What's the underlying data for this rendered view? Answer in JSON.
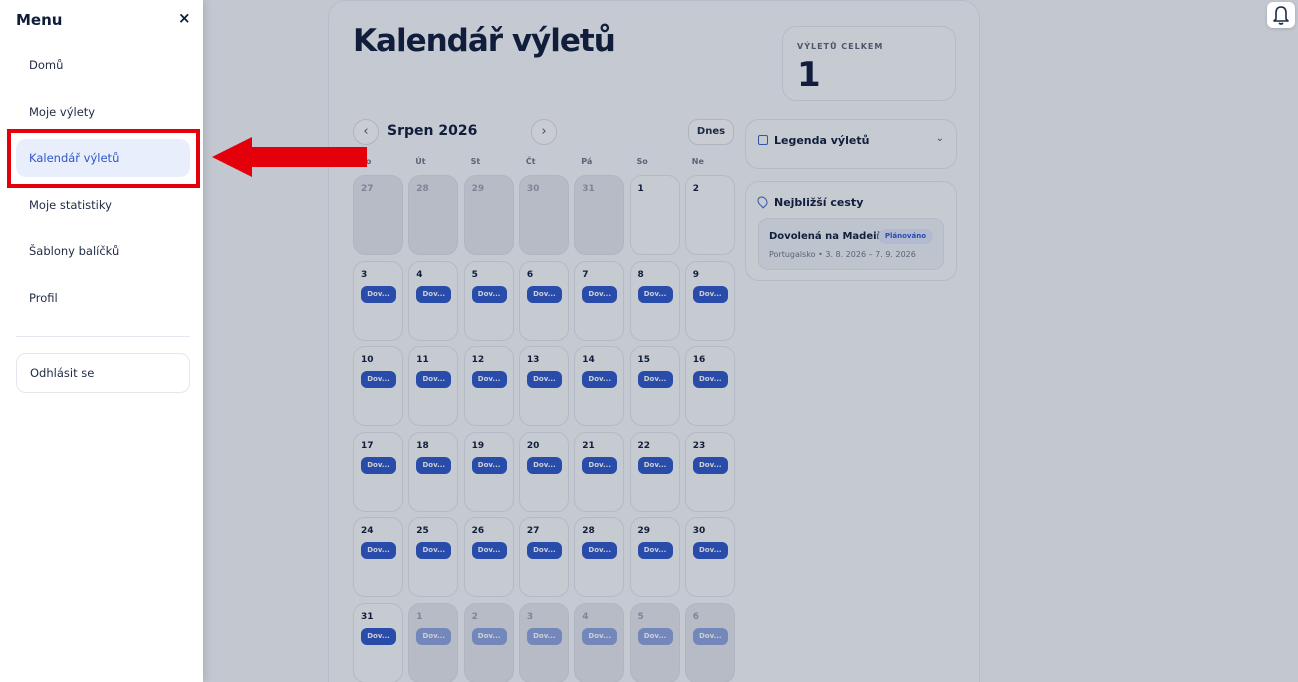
{
  "page": {
    "title": "Kalendář výletů",
    "stat_label": "VÝLETŮ CELKEM",
    "stat_value": "1"
  },
  "calendar": {
    "month": "Srpen 2026",
    "today_label": "Dnes",
    "prev_icon": "chevron-left-icon",
    "next_icon": "chevron-right-icon",
    "weekdays": [
      "Po",
      "Út",
      "St",
      "Čt",
      "Pá",
      "So",
      "Ne"
    ],
    "event_label": "Dov...",
    "weeks": [
      [
        {
          "d": "27",
          "out": true,
          "ev": false
        },
        {
          "d": "28",
          "out": true,
          "ev": false
        },
        {
          "d": "29",
          "out": true,
          "ev": false
        },
        {
          "d": "30",
          "out": true,
          "ev": false
        },
        {
          "d": "31",
          "out": true,
          "ev": false
        },
        {
          "d": "1",
          "out": false,
          "ev": false
        },
        {
          "d": "2",
          "out": false,
          "ev": false
        }
      ],
      [
        {
          "d": "3",
          "out": false,
          "ev": true
        },
        {
          "d": "4",
          "out": false,
          "ev": true
        },
        {
          "d": "5",
          "out": false,
          "ev": true
        },
        {
          "d": "6",
          "out": false,
          "ev": true
        },
        {
          "d": "7",
          "out": false,
          "ev": true
        },
        {
          "d": "8",
          "out": false,
          "ev": true
        },
        {
          "d": "9",
          "out": false,
          "ev": true
        }
      ],
      [
        {
          "d": "10",
          "out": false,
          "ev": true
        },
        {
          "d": "11",
          "out": false,
          "ev": true
        },
        {
          "d": "12",
          "out": false,
          "ev": true
        },
        {
          "d": "13",
          "out": false,
          "ev": true
        },
        {
          "d": "14",
          "out": false,
          "ev": true
        },
        {
          "d": "15",
          "out": false,
          "ev": true
        },
        {
          "d": "16",
          "out": false,
          "ev": true
        }
      ],
      [
        {
          "d": "17",
          "out": false,
          "ev": true
        },
        {
          "d": "18",
          "out": false,
          "ev": true
        },
        {
          "d": "19",
          "out": false,
          "ev": true
        },
        {
          "d": "20",
          "out": false,
          "ev": true
        },
        {
          "d": "21",
          "out": false,
          "ev": true
        },
        {
          "d": "22",
          "out": false,
          "ev": true
        },
        {
          "d": "23",
          "out": false,
          "ev": true
        }
      ],
      [
        {
          "d": "24",
          "out": false,
          "ev": true
        },
        {
          "d": "25",
          "out": false,
          "ev": true
        },
        {
          "d": "26",
          "out": false,
          "ev": true
        },
        {
          "d": "27",
          "out": false,
          "ev": true
        },
        {
          "d": "28",
          "out": false,
          "ev": true
        },
        {
          "d": "29",
          "out": false,
          "ev": true
        },
        {
          "d": "30",
          "out": false,
          "ev": true
        }
      ],
      [
        {
          "d": "31",
          "out": false,
          "ev": true
        },
        {
          "d": "1",
          "out": true,
          "ev": true
        },
        {
          "d": "2",
          "out": true,
          "ev": true
        },
        {
          "d": "3",
          "out": true,
          "ev": true
        },
        {
          "d": "4",
          "out": true,
          "ev": true
        },
        {
          "d": "5",
          "out": true,
          "ev": true
        },
        {
          "d": "6",
          "out": true,
          "ev": true
        }
      ]
    ]
  },
  "legend": {
    "title": "Legenda výletů",
    "icon": "calendar-icon",
    "toggle_icon": "chevron-down-icon"
  },
  "upcoming": {
    "title": "Nejbližší cesty",
    "icon": "map-pin-icon",
    "trip": {
      "name": "Dovolená na Madeiře",
      "status": "Plánováno",
      "meta": "Portugalsko • 3. 8. 2026 – 7. 9. 2026"
    }
  },
  "header": {
    "notification_icon": "bell-icon"
  },
  "menu": {
    "title": "Menu",
    "close_icon": "close-icon",
    "items": [
      {
        "label": "Domů",
        "active": false
      },
      {
        "label": "Moje výlety",
        "active": false
      },
      {
        "label": "Kalendář výletů",
        "active": true
      },
      {
        "label": "Moje statistiky",
        "active": false
      },
      {
        "label": "Šablony balíčků",
        "active": false
      },
      {
        "label": "Profil",
        "active": false
      }
    ],
    "logout_label": "Odhlásit se"
  },
  "colors": {
    "accent": "#2f57c9",
    "annotation": "#e3000b",
    "active_bg": "#e8eefc"
  }
}
